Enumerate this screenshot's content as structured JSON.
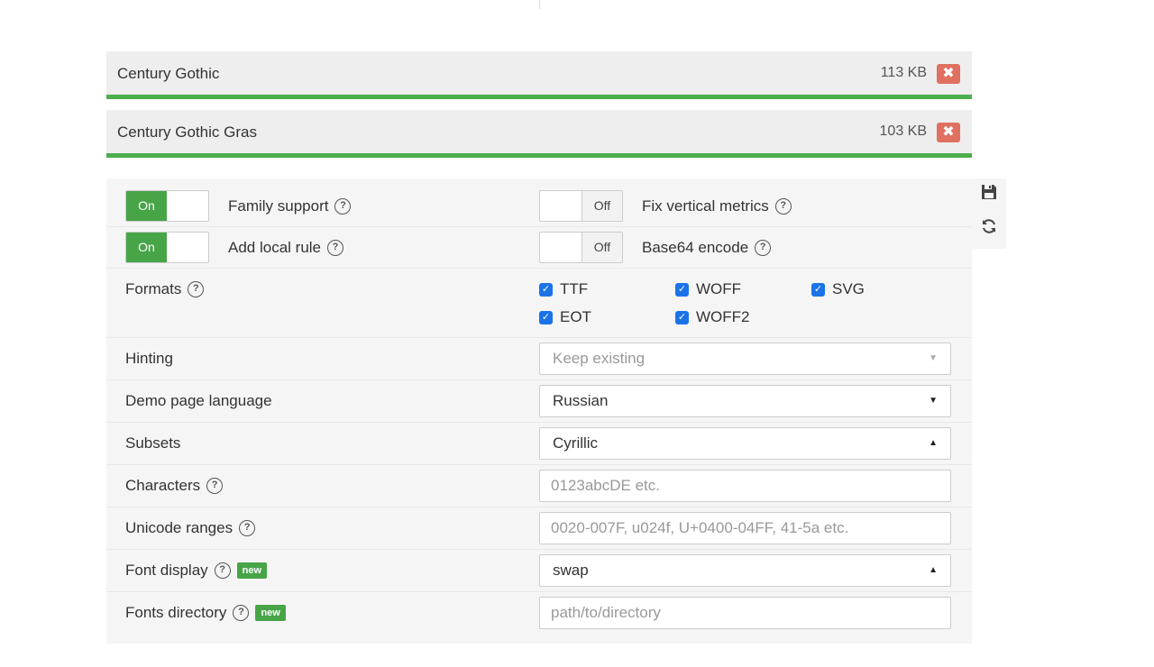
{
  "fonts": [
    {
      "name": "Century Gothic",
      "size": "113 KB"
    },
    {
      "name": "Century Gothic Gras",
      "size": "103 KB"
    }
  ],
  "toggles": {
    "family_support": {
      "label": "Family support",
      "state": "On"
    },
    "fix_vertical_metrics": {
      "label": "Fix vertical metrics",
      "state": "Off"
    },
    "add_local_rule": {
      "label": "Add local rule",
      "state": "On"
    },
    "base64_encode": {
      "label": "Base64 encode",
      "state": "Off"
    }
  },
  "formats": {
    "label": "Formats",
    "options": [
      "TTF",
      "WOFF",
      "SVG",
      "EOT",
      "WOFF2"
    ]
  },
  "hinting": {
    "label": "Hinting",
    "value": "Keep existing"
  },
  "demo_language": {
    "label": "Demo page language",
    "value": "Russian"
  },
  "subsets": {
    "label": "Subsets",
    "value": "Cyrillic"
  },
  "characters": {
    "label": "Characters",
    "placeholder": "0123abcDE etc."
  },
  "unicode_ranges": {
    "label": "Unicode ranges",
    "placeholder": "0020-007F, u024f, U+0400-04FF, 41-5a etc."
  },
  "font_display": {
    "label": "Font display",
    "badge": "new",
    "value": "swap"
  },
  "fonts_directory": {
    "label": "Fonts directory",
    "badge": "new",
    "placeholder": "path/to/directory"
  },
  "icons": {
    "remove": "close-icon",
    "save": "floppy-disk-icon",
    "refresh": "refresh-icon",
    "help": "question-circle-icon",
    "checkbox": "check-icon"
  },
  "colors": {
    "accent_green": "#47a447",
    "remove_red": "#e0705f",
    "checkbox_blue": "#1a73e8"
  }
}
